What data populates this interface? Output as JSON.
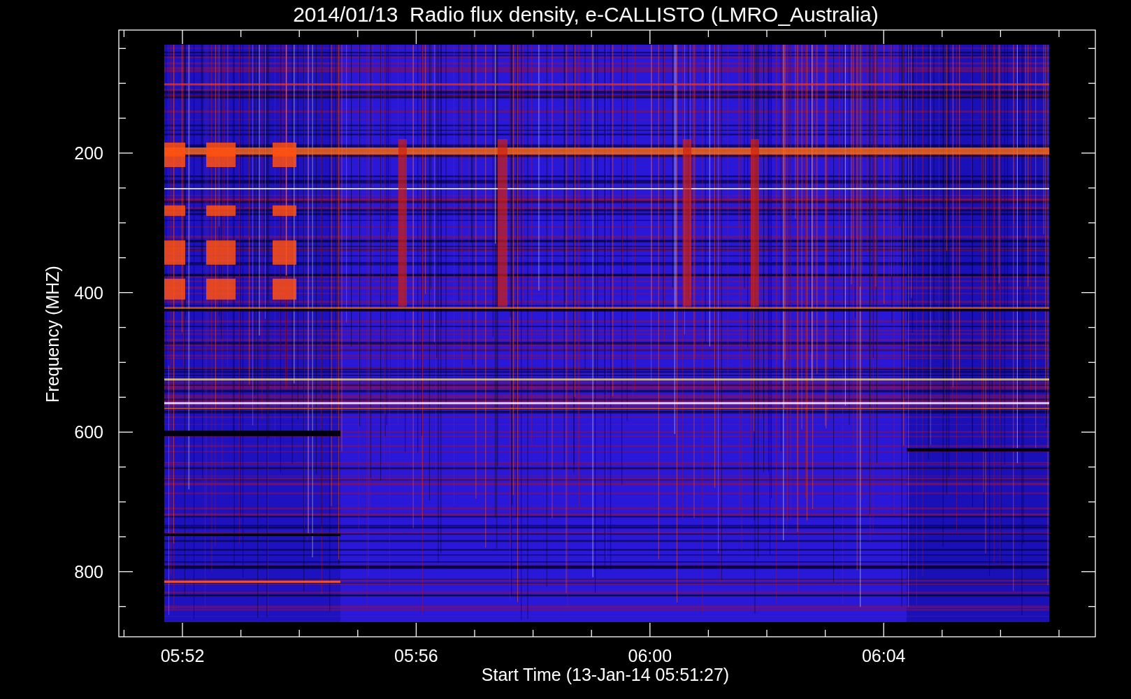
{
  "plot": {
    "title": "2014/01/13  Radio flux density, e-CALLISTO (LMRO_Australia)",
    "ylabel": "Frequency (MHZ)",
    "xlabel": "Start Time (13-Jan-14 05:51:27)",
    "y_tick_labels": [
      "200",
      "400",
      "600",
      "800"
    ],
    "x_tick_labels": [
      "05:52",
      "05:56",
      "06:00",
      "06:04"
    ]
  }
}
